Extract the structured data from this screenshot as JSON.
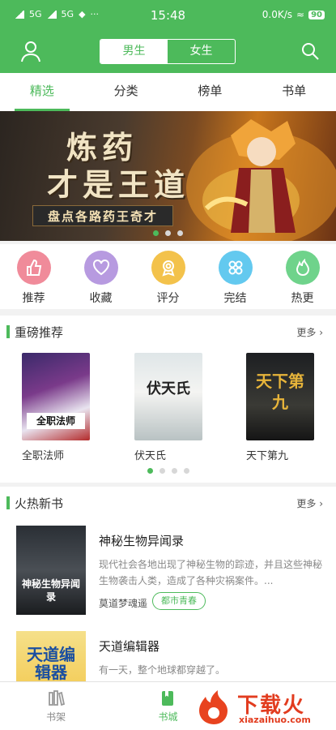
{
  "status": {
    "network1": "5G",
    "network2": "5G",
    "time": "15:48",
    "speed": "0.0K/s",
    "battery": "90"
  },
  "header": {
    "gender_male": "男生",
    "gender_female": "女生"
  },
  "tabs": [
    {
      "label": "精选"
    },
    {
      "label": "分类"
    },
    {
      "label": "榜单"
    },
    {
      "label": "书单"
    }
  ],
  "banner": {
    "title_line1": "炼药",
    "title_line2": "才是王道",
    "subtitle": "盘点各路药王奇才"
  },
  "categories": [
    {
      "label": "推荐",
      "color": "#f08b9a",
      "icon": "thumb-up-icon"
    },
    {
      "label": "收藏",
      "color": "#b79ae0",
      "icon": "heart-icon"
    },
    {
      "label": "评分",
      "color": "#f3c24b",
      "icon": "award-icon"
    },
    {
      "label": "完结",
      "color": "#63c9ef",
      "icon": "grid-icon"
    },
    {
      "label": "热更",
      "color": "#6fd38b",
      "icon": "flame-icon"
    }
  ],
  "featured": {
    "title": "重磅推荐",
    "more": "更多",
    "books": [
      {
        "title": "全职法师",
        "cover_text": "全职法师"
      },
      {
        "title": "伏天氏",
        "cover_text": "伏天氏"
      },
      {
        "title": "天下第九",
        "cover_text": "天下第九"
      }
    ]
  },
  "new_books": {
    "title": "火热新书",
    "more": "更多",
    "items": [
      {
        "title": "神秘生物异闻录",
        "description": "现代社会各地出现了神秘生物的踪迹，并且这些神秘生物袭击人类，造成了各种灾祸案件。...",
        "author": "莫道梦魂遥",
        "tag": "都市青春",
        "cover_text": "神秘生物异闻录"
      },
      {
        "title": "天道编辑器",
        "description": "有一天，整个地球都穿越了。",
        "author": "",
        "tag": "",
        "cover_text": "天道编辑器"
      }
    ]
  },
  "bottom_nav": [
    {
      "label": "书架"
    },
    {
      "label": "书城"
    }
  ],
  "watermark": {
    "cn": "下载火",
    "en": "xiazaihuo.com"
  },
  "colors": {
    "accent": "#4dba5b"
  }
}
